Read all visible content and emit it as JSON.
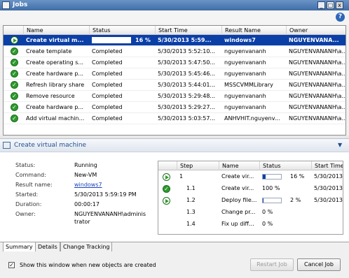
{
  "window": {
    "title": "Jobs"
  },
  "grid": {
    "columns": [
      "Name",
      "Status",
      "Start Time",
      "Result Name",
      "Owner"
    ],
    "rows": [
      {
        "name": "Create virtual m...",
        "status": "",
        "progress_pct": 16,
        "pct_label": "16 %",
        "start": "5/30/2013 5:59...",
        "result": "windows7",
        "owner": "NGUYENVANA...",
        "selected": true
      },
      {
        "name": "Create template",
        "status": "Completed",
        "start": "5/30/2013 5:52:10...",
        "result": "nguyenvananh",
        "owner": "NGUYENVANANH\\a..."
      },
      {
        "name": "Create operating s...",
        "status": "Completed",
        "start": "5/30/2013 5:47:50...",
        "result": "nguyenvananh",
        "owner": "NGUYENVANANH\\a..."
      },
      {
        "name": "Create hardware p...",
        "status": "Completed",
        "start": "5/30/2013 5:45:46...",
        "result": "nguyenvananh",
        "owner": "NGUYENVANANH\\a..."
      },
      {
        "name": "Refresh library share",
        "status": "Completed",
        "start": "5/30/2013 5:44:01...",
        "result": "MSSCVMMLibrary",
        "owner": "NGUYENVANANH\\a..."
      },
      {
        "name": "Remove resource",
        "status": "Completed",
        "start": "5/30/2013 5:29:48...",
        "result": "nguyenvananh",
        "owner": "NGUYENVANANH\\a..."
      },
      {
        "name": "Create hardware p...",
        "status": "Completed",
        "start": "5/30/2013 5:29:27...",
        "result": "nguyenvananh",
        "owner": "NGUYENVANANH\\a..."
      },
      {
        "name": "Add virtual machin...",
        "status": "Completed",
        "start": "5/30/2013 5:03:57...",
        "result": "ANHVHIT.nguyenv...",
        "owner": "NGUYENVANANH\\a..."
      }
    ]
  },
  "detail": {
    "title": "Create virtual machine",
    "fields": [
      {
        "label": "Status:",
        "value": "Running"
      },
      {
        "label": "Command:",
        "value": "New-VM"
      },
      {
        "label": "Result name:",
        "value": "windows7",
        "link": true
      },
      {
        "label": "Started:",
        "value": "5/30/2013 5:59:19 PM"
      },
      {
        "label": "Duration:",
        "value": "00:00:17"
      },
      {
        "label": "Owner:",
        "value": "NGUYENVANANH\\adminis",
        "value2": "trator"
      }
    ],
    "steps": {
      "columns": [
        "Step",
        "Name",
        "Status",
        "Start Time"
      ],
      "rows": [
        {
          "icon": "run",
          "step": "1",
          "name": "Create vir...",
          "progress_pct": 16,
          "status": "16 %",
          "start": "5/30/2013"
        },
        {
          "icon": "ok",
          "step": "1.1",
          "name": "Create vir...",
          "status": "100 %",
          "start": "5/30/2013"
        },
        {
          "icon": "run",
          "step": "1.2",
          "name": "Deploy file...",
          "progress_pct": 2,
          "status": "2 %",
          "start": "5/30/2013"
        },
        {
          "icon": "",
          "step": "1.3",
          "name": "Change pr...",
          "status": "0 %",
          "start": ""
        },
        {
          "icon": "",
          "step": "1.4",
          "name": "Fix up diff...",
          "status": "0 %",
          "start": ""
        }
      ]
    }
  },
  "tabs": [
    "Summary",
    "Details",
    "Change Tracking"
  ],
  "footer": {
    "checkbox_label": "Show this window when new objects are created",
    "checkbox_checked": "✓",
    "restart_label": "Restart Job",
    "cancel_label": "Cancel Job"
  },
  "titlebar_buttons": {
    "min": "_",
    "max": "□",
    "close": "x"
  },
  "help": "?",
  "chevron": "▼",
  "colors": {
    "selection": "#0b3fa8",
    "ok_green": "#2d9a2d",
    "link": "#1a44b8"
  }
}
